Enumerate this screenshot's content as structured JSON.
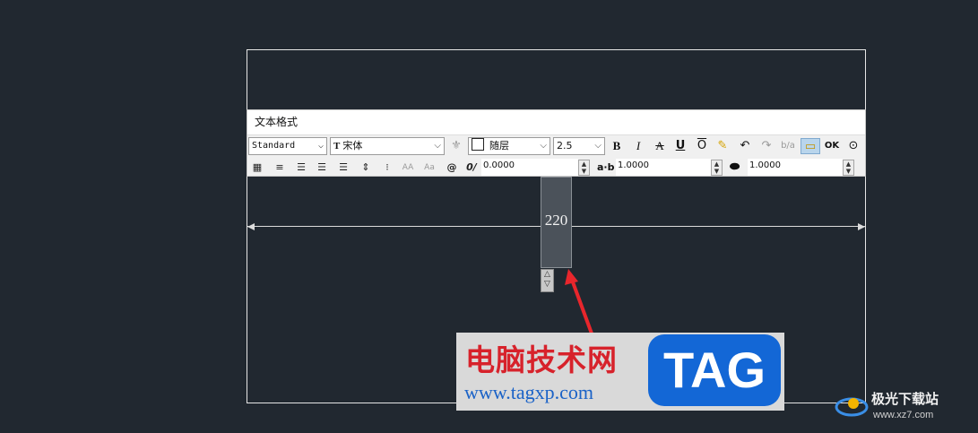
{
  "toolbar": {
    "title": "文本格式",
    "style_select": "Standard",
    "font_select": "宋体",
    "color_select": "随层",
    "height_select": "2.5",
    "ok_label": "OK",
    "bold_label": "B",
    "italic_label": "I",
    "strike_label": "A",
    "underline_label": "U",
    "overline_label": "O",
    "oblique_value": "0.0000",
    "tracking_value": "1.0000",
    "width_factor_value": "1.0000",
    "tracking_icon_label": "a·b"
  },
  "drawing": {
    "dimension_text": "220"
  },
  "watermark": {
    "title": "电脑技术网",
    "url": "www.tagxp.com",
    "tag": "TAG"
  },
  "brand": {
    "name": "极光下载站",
    "url": "www.xz7.com"
  },
  "colors": {
    "canvas_bg": "#212830",
    "watermark_red": "#d7222b",
    "tag_blue": "#1367d6",
    "arrow_red": "#e8262c"
  }
}
